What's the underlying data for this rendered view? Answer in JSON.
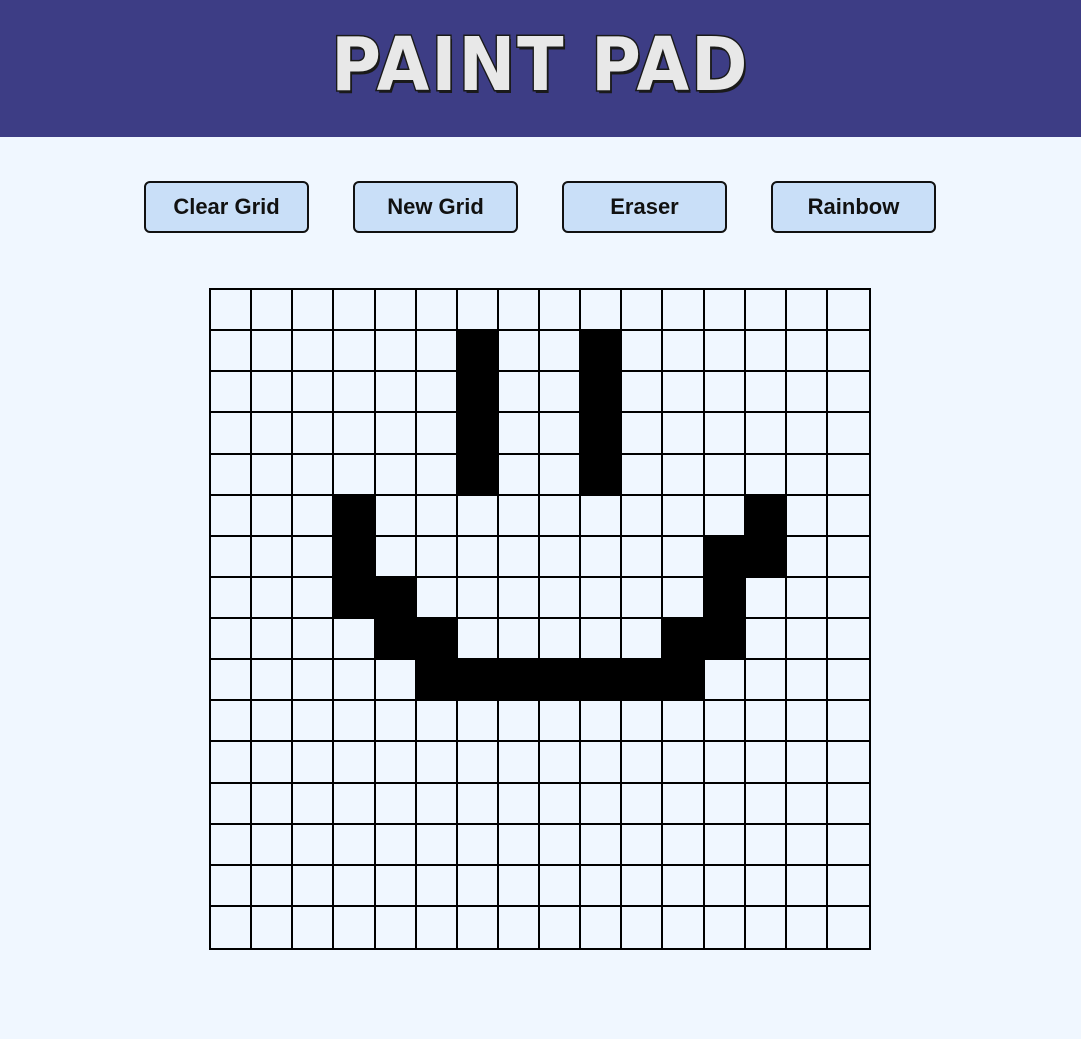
{
  "app": {
    "title": "PAINT PAD"
  },
  "toolbar": {
    "clear_label": "Clear Grid",
    "new_label": "New Grid",
    "eraser_label": "Eraser",
    "rainbow_label": "Rainbow"
  },
  "colors": {
    "header_bg": "#3d3d85",
    "page_bg": "#f0f7ff",
    "button_bg": "#c9dff8",
    "paint": "#000000"
  },
  "grid": {
    "rows": 16,
    "cols": 16,
    "filled": [
      [
        1,
        6
      ],
      [
        1,
        9
      ],
      [
        2,
        6
      ],
      [
        2,
        9
      ],
      [
        3,
        6
      ],
      [
        3,
        9
      ],
      [
        4,
        6
      ],
      [
        4,
        9
      ],
      [
        5,
        3
      ],
      [
        5,
        13
      ],
      [
        6,
        3
      ],
      [
        6,
        12
      ],
      [
        6,
        13
      ],
      [
        7,
        3
      ],
      [
        7,
        4
      ],
      [
        7,
        12
      ],
      [
        8,
        4
      ],
      [
        8,
        5
      ],
      [
        8,
        11
      ],
      [
        8,
        12
      ],
      [
        9,
        5
      ],
      [
        9,
        6
      ],
      [
        9,
        7
      ],
      [
        9,
        8
      ],
      [
        9,
        9
      ],
      [
        9,
        10
      ],
      [
        9,
        11
      ]
    ]
  }
}
